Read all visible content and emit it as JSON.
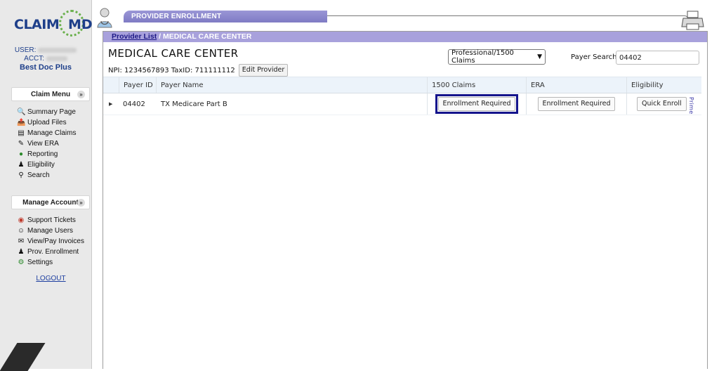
{
  "brand": {
    "logo_left": "CLAIM",
    "logo_right": "MD"
  },
  "user": {
    "user_label": "USER:",
    "acct_label": "ACCT:",
    "plan": "Best Doc Plus"
  },
  "claim_menu": {
    "title": "Claim Menu",
    "items": [
      {
        "label": "Summary Page",
        "icon": "summary-icon"
      },
      {
        "label": "Upload Files",
        "icon": "upload-icon"
      },
      {
        "label": "Manage Claims",
        "icon": "claims-icon"
      },
      {
        "label": "View ERA",
        "icon": "era-icon"
      },
      {
        "label": "Reporting",
        "icon": "reporting-icon"
      },
      {
        "label": "Eligibility",
        "icon": "eligibility-icon"
      },
      {
        "label": "Search",
        "icon": "search-icon"
      }
    ]
  },
  "account_menu": {
    "title": "Manage Account",
    "items": [
      {
        "label": "Support Tickets",
        "icon": "support-icon"
      },
      {
        "label": "Manage Users",
        "icon": "users-icon"
      },
      {
        "label": "View/Pay Invoices",
        "icon": "invoice-icon"
      },
      {
        "label": "Prov. Enrollment",
        "icon": "enrollment-icon"
      },
      {
        "label": "Settings",
        "icon": "settings-icon"
      }
    ]
  },
  "logout_label": "LOGOUT",
  "banner": {
    "title": "PROVIDER ENROLLMENT"
  },
  "breadcrumb": {
    "link": "Provider List",
    "separator": " / ",
    "current": "MEDICAL CARE CENTER"
  },
  "provider": {
    "name": "MEDICAL CARE CENTER",
    "npi_text": "NPI: 1234567893 TaxID: 711111112",
    "edit_label": "Edit Provider"
  },
  "claims_select": {
    "selected": "Professional/1500 Claims"
  },
  "payer_search": {
    "label": "Payer Search",
    "value": "04402"
  },
  "table": {
    "headers": {
      "payer_id": "Payer ID",
      "payer_name": "Payer Name",
      "claims": "1500 Claims",
      "era": "ERA",
      "eligibility": "Eligibility"
    },
    "rows": [
      {
        "payer_id": "04402",
        "payer_name": "TX Medicare Part B",
        "claims_action": "Enrollment Required",
        "era_action": "Enrollment Required",
        "eligibility_action": "Quick Enroll",
        "eligibility_note": "Prime"
      }
    ]
  },
  "colors": {
    "brand_blue": "#1e3f8a",
    "banner_purple": "#8a86cc",
    "highlight": "#14148c"
  }
}
